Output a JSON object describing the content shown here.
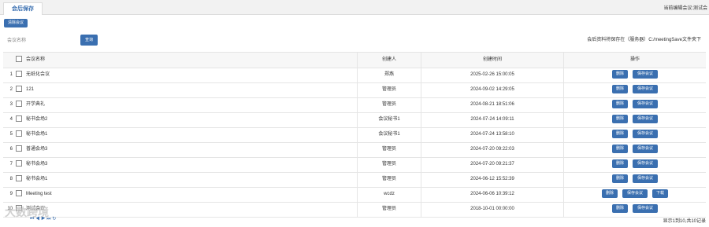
{
  "tabs": [
    {
      "label": "会后保存"
    }
  ],
  "header": {
    "meeting_info": "当前编辑会议:测试会"
  },
  "toolbar": {
    "clear_label": "清除会议"
  },
  "search": {
    "label": "会议名称",
    "value": "",
    "button_label": "查询"
  },
  "save_note": "会后资料将保存在（服务器）C:/meetingSave文件夹下",
  "table": {
    "headers": {
      "name": "会议名称",
      "creator": "创建人",
      "time": "创建时间",
      "ops": "操作"
    },
    "rows": [
      {
        "num": "1",
        "name": "无纸化会议",
        "creator": "郑燕",
        "time": "2025-02-26 15:00:05",
        "ops": [
          "删除",
          "保存会议"
        ]
      },
      {
        "num": "2",
        "name": "121",
        "creator": "管理员",
        "time": "2024-09-02 14:29:05",
        "ops": [
          "删除",
          "保存会议"
        ]
      },
      {
        "num": "3",
        "name": "开学典礼",
        "creator": "管理员",
        "time": "2024-08-21 18:51:06",
        "ops": [
          "删除",
          "保存会议"
        ]
      },
      {
        "num": "4",
        "name": "秘书会场2",
        "creator": "会议秘书1",
        "time": "2024-07-24 14:09:11",
        "ops": [
          "删除",
          "保存会议"
        ]
      },
      {
        "num": "5",
        "name": "秘书会场1",
        "creator": "会议秘书1",
        "time": "2024-07-24 13:58:10",
        "ops": [
          "删除",
          "保存会议"
        ]
      },
      {
        "num": "6",
        "name": "普通会场3",
        "creator": "管理员",
        "time": "2024-07-20 09:22:03",
        "ops": [
          "删除",
          "保存会议"
        ]
      },
      {
        "num": "7",
        "name": "秘书会场3",
        "creator": "管理员",
        "time": "2024-07-20 09:21:37",
        "ops": [
          "删除",
          "保存会议"
        ]
      },
      {
        "num": "8",
        "name": "秘书会场1",
        "creator": "管理员",
        "time": "2024-06-12 15:52:39",
        "ops": [
          "删除",
          "保存会议"
        ]
      },
      {
        "num": "9",
        "name": "Meeting test",
        "creator": "wcdz",
        "time": "2024-06-06 10:39:12",
        "ops": [
          "删除",
          "保存会议",
          "下载"
        ]
      },
      {
        "num": "10",
        "name": "测试会议",
        "creator": "管理员",
        "time": "2018-10-01 00:00:00",
        "ops": [
          "删除",
          "保存会议"
        ]
      }
    ]
  },
  "pager": {
    "info": "显示1到10,共10记录"
  },
  "watermark": "大数跨境"
}
